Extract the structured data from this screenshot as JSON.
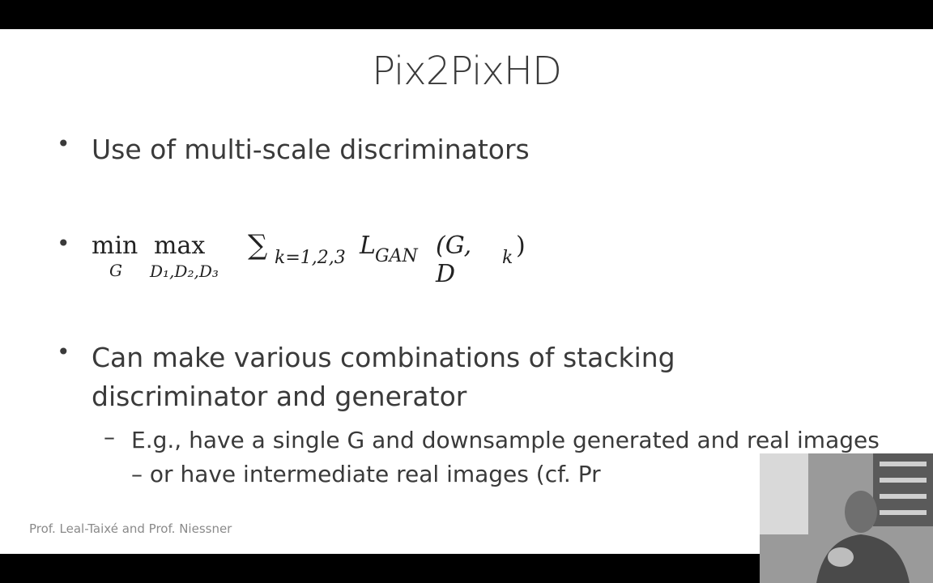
{
  "slide": {
    "title": "Pix2PixHD",
    "bullets": [
      "Use of multi-scale discriminators",
      "Can make various combinations of stacking discriminator and generator"
    ],
    "sub_bullet": "E.g., have a single G and downsample generated and real images – or have intermediate real images (cf. Pr",
    "formula": {
      "min": "min",
      "min_sub": "G",
      "max": "max",
      "max_sub": "D₁,D₂,D₃",
      "sum": "∑",
      "sum_sub": "k=1,2,3",
      "loss": "L",
      "loss_sub": "GAN",
      "args": "(G, D",
      "args_sub": "k",
      "close": ")"
    },
    "bullet_symbol": "•",
    "dash_symbol": "–",
    "footer": "Prof. Leal-Taixé and Prof. Niessner"
  }
}
